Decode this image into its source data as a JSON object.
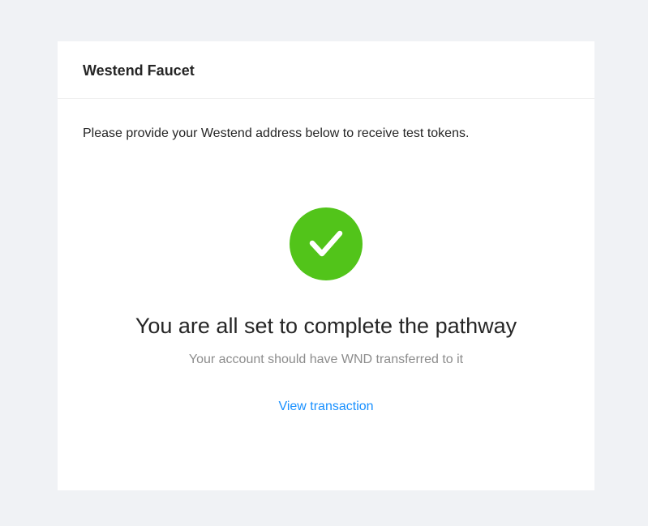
{
  "card": {
    "title": "Westend Faucet",
    "intro": "Please provide your Westend address below to receive test tokens."
  },
  "result": {
    "icon": "check-circle-icon",
    "title": "You are all set to complete the pathway",
    "subtitle": "Your account should have WND transferred to it",
    "link_label": "View transaction"
  },
  "colors": {
    "page_background": "#f0f2f5",
    "card_background": "#ffffff",
    "success": "#52c41a",
    "link": "#1890ff",
    "secondary_text": "#8c8c8c"
  }
}
